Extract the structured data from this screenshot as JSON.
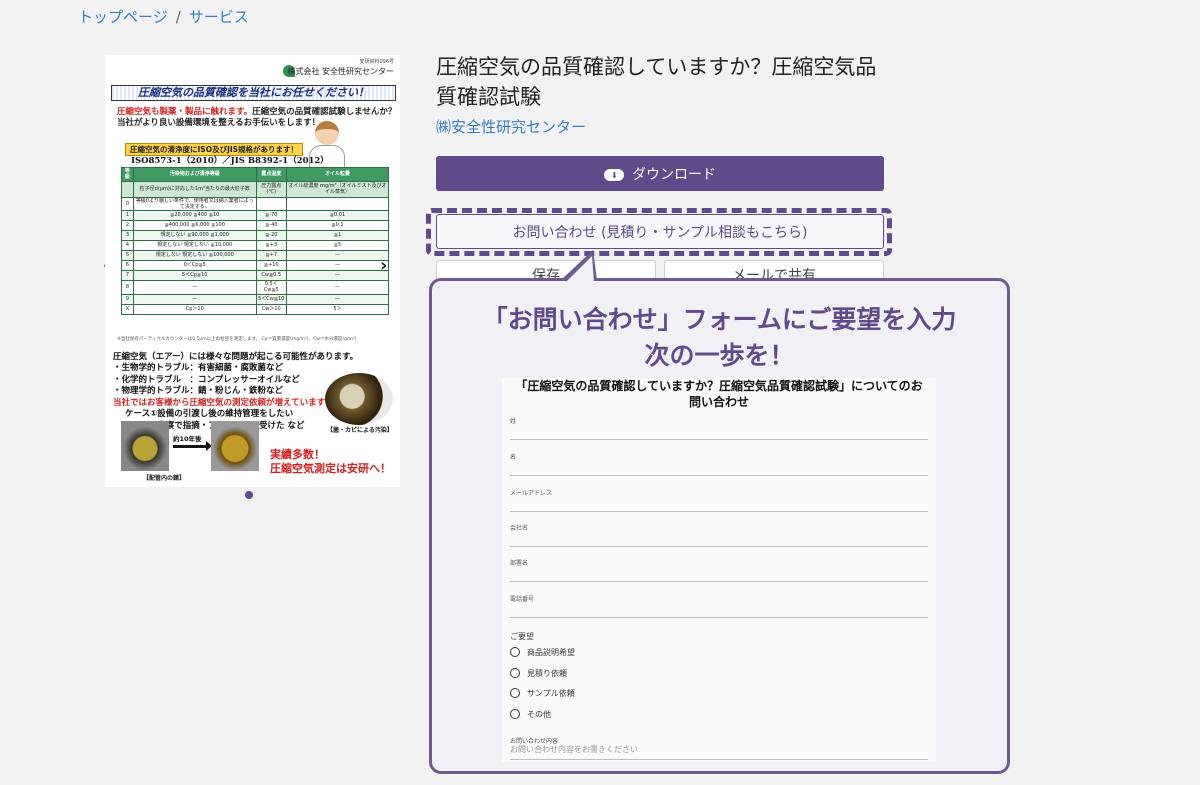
{
  "breadcrumb": {
    "items": [
      "トップページ",
      "サービス"
    ],
    "separator": "/"
  },
  "carousel": {
    "prev": "‹",
    "next": "›",
    "doc": {
      "header_line": "安研資料096号",
      "org": "株式会社 安全性研究センター",
      "banner": "圧縮空気の品質確認を当社にお任せください！",
      "p1_red": "圧縮空気も製薬・製品に触れます。",
      "p1_rest": "圧縮空気の品質確認試験しませんか？",
      "p2": "当社がより良い設備環境を整えるお手伝いをします！",
      "tag": "圧縮空気の清浄度にISO及びJIS規格があります！",
      "iso": "ISO8573-1（2010）／JIS B8392-1（2012）",
      "table": {
        "header": [
          "等級",
          "汚染物および清浄等級",
          "露点温度",
          "オイル粒量"
        ],
        "subheader": [
          "",
          "粒子径d(μm)に対応した1m³当たりの最大粒子数",
          "圧力露点(℃)",
          "オイル総濃度 mg/m³（オイルミスト及びオイル蒸気）"
        ],
        "rows": [
          [
            "0",
            "等級0より厳しい条件で、使用者又は納入業者によって決定する。",
            "",
            ""
          ],
          [
            "1",
            "≦20,000 ≦400 ≦10",
            "≦-70",
            "≦0.01"
          ],
          [
            "2",
            "≦400,000 ≦6,000 ≦100",
            "≦-40",
            "≦0.1"
          ],
          [
            "3",
            "規定しない ≦90,000 ≦1,000",
            "≦-20",
            "≦1"
          ],
          [
            "4",
            "規定しない 規定しない ≦10,000",
            "≦+3",
            "≦5"
          ],
          [
            "5",
            "規定しない 規定しない ≦100,000",
            "≦+7",
            "—"
          ],
          [
            "6",
            "0＜Cp≦5",
            "≦+10",
            "—"
          ],
          [
            "7",
            "5＜Cp≦10",
            "Cw≦0.5",
            "—"
          ],
          [
            "8",
            "—",
            "0.5＜Cw≦5",
            "—"
          ],
          [
            "9",
            "—",
            "5＜Cw≦10",
            "—"
          ],
          [
            "X",
            "Cp＞10",
            "Cw＞10",
            "5＞"
          ]
        ]
      },
      "note": "※当社保有パーティクルカウンターは0.5μm以上の粒径を測定します。 Cp＝質量濃度(mg/m³)、Cw＝水分濃度(g/m³)",
      "body_lines": [
        "圧縮空気（エアー）には様々な問題が起こる可能性があります。",
        "・生物学的トラブル：有害細菌・腐敗菌など",
        "・化学的トラブル　：コンプレッサーオイルなど",
        "・物理学的トラブル：錆・粉じん・鉄粉など"
      ],
      "body_red": "当社ではお客様から圧縮空気の測定依頼が増えています！",
      "cases": [
        "ケース①設備の引渡し後の維持管理をしたい",
        "ケース②審察で指摘・アドバイスを受けた など"
      ],
      "micro_caption": "【菌・カビによる汚染】",
      "arrow_label": "約10年後",
      "pipe_caption": "【配管内の錆】",
      "big_lines": [
        "実績多数！",
        "圧縮空気測定は安研へ！"
      ]
    }
  },
  "product": {
    "title": "圧縮空気の品質確認していますか？圧縮空気品質確認試験",
    "company": "㈱安全性研究センター"
  },
  "actions": {
    "download": "ダウンロード",
    "inquiry": "お問い合わせ (見積り・サンプル相談もこちら)",
    "save": "保存",
    "mail": "メールで共有"
  },
  "callout": {
    "line1": "「お問い合わせ」フォームにご要望を入力",
    "line2": "次の一歩を！"
  },
  "form": {
    "title": "「圧縮空気の品質確認していますか？圧縮空気品質確認試験」についてのお問い合わせ",
    "fields": [
      {
        "label": "姓"
      },
      {
        "label": "名"
      },
      {
        "label": "メールアドレス"
      },
      {
        "label": "会社名"
      },
      {
        "label": "部署名"
      },
      {
        "label": "電話番号"
      }
    ],
    "request_label": "ご要望",
    "options": [
      "商品説明希望",
      "見積り依頼",
      "サンプル依頼",
      "その他"
    ],
    "textarea_label": "お問い合わせ内容",
    "textarea_placeholder": "お問い合わせ内容をお書きください"
  },
  "colors": {
    "brand": "#5f4b8b",
    "link": "#3a7bc8"
  }
}
